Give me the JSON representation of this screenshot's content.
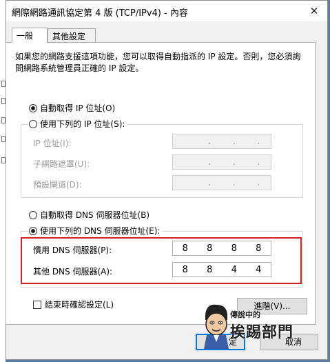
{
  "window": {
    "title": "網際網路通訊協定第 4 版 (TCP/IPv4) - 內容",
    "close_icon": "close-icon"
  },
  "tabs": [
    {
      "label": "一般",
      "active": true
    },
    {
      "label": "其他設定",
      "active": false
    }
  ],
  "description": "如果您的網路支援這項功能，您可以取得自動指派的 IP 設定。否則，您必須詢問網路系統管理員正確的 IP 設定。",
  "ip_section": {
    "auto_label": "自動取得 IP 位址(O)",
    "auto_checked": true,
    "manual_label": "使用下列的 IP 位址(S):",
    "manual_checked": false,
    "fields": [
      {
        "label": "IP 位址(I):",
        "value": [
          ".",
          ".",
          "."
        ]
      },
      {
        "label": "子網路遮罩(U):",
        "value": [
          ".",
          ".",
          "."
        ]
      },
      {
        "label": "預設閘道(D):",
        "value": [
          ".",
          ".",
          "."
        ]
      }
    ]
  },
  "dns_section": {
    "auto_label": "自動取得 DNS 伺服器位址(B)",
    "auto_checked": false,
    "manual_label": "使用下列的 DNS 伺服器位址(E):",
    "manual_checked": true,
    "preferred": {
      "label": "慣用 DNS 伺服器(P):",
      "octets": [
        "8",
        "8",
        "8",
        "8"
      ]
    },
    "alternate": {
      "label": "其他 DNS 伺服器(A):",
      "octets": [
        "8",
        "8",
        "4",
        "4"
      ]
    }
  },
  "validate_checkbox": {
    "label": "結束時確認設定(L)",
    "checked": false
  },
  "buttons": {
    "advanced": "進階(V)...",
    "ok": "定",
    "cancel": "取消"
  },
  "watermark": {
    "line1": "傳說中的",
    "line2": "挨踢部門",
    "note": "watermark logo"
  },
  "colors": {
    "highlight_border": "#d21f1f",
    "ok_border": "#0078d7",
    "desktop": "#5a7fa6"
  }
}
